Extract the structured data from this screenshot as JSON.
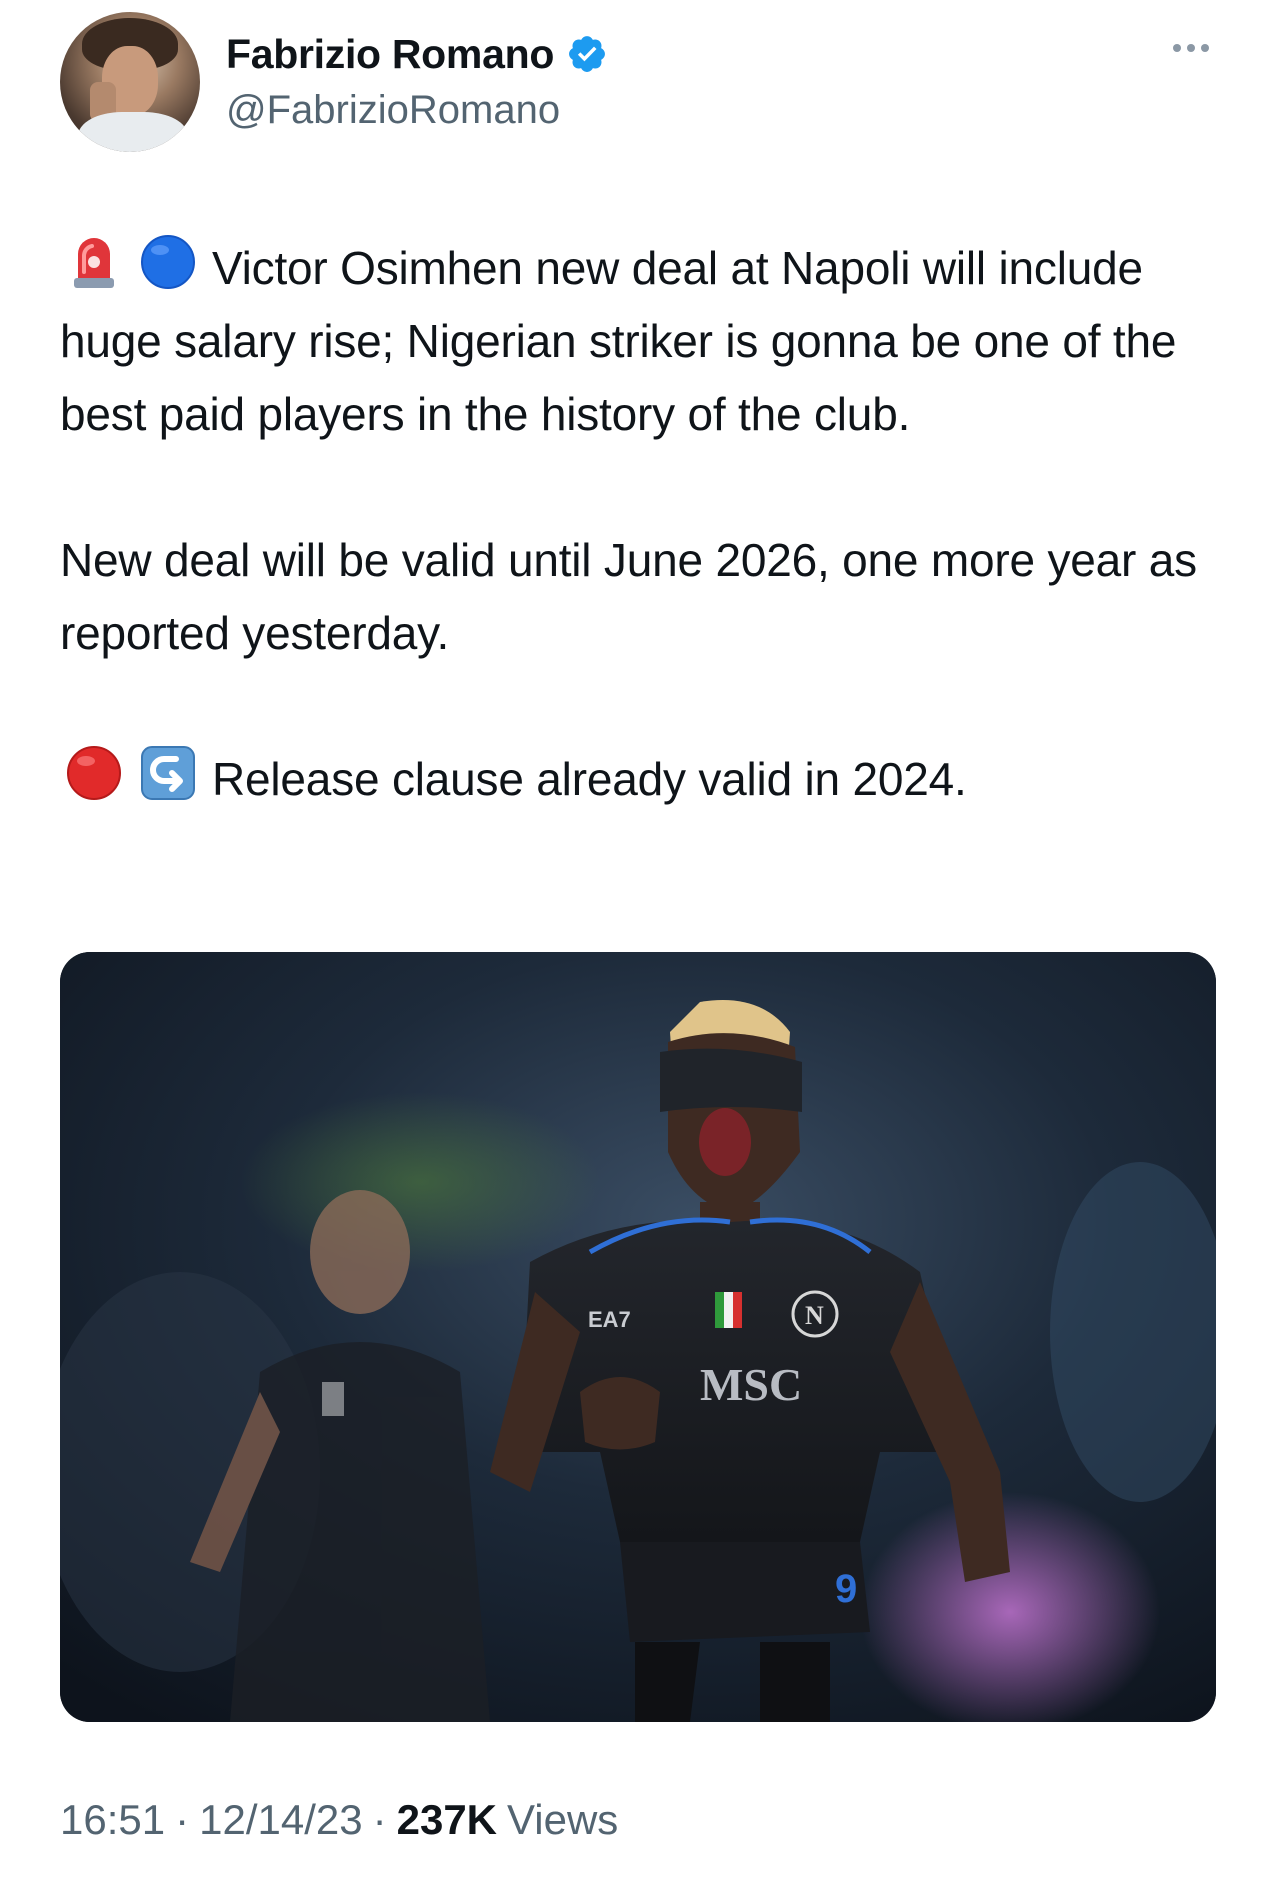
{
  "author": {
    "display_name": "Fabrizio Romano",
    "handle": "@FabrizioRomano",
    "verified": true,
    "verified_color": "#1d9bf0"
  },
  "menu": {
    "icon": "more-horizontal-icon"
  },
  "tweet": {
    "line1_emojis": [
      "rotating-light-emoji",
      "blue-circle-emoji"
    ],
    "paragraph1": "Victor Osimhen new deal at Napoli will include huge salary rise; Nigerian striker is gonna be one of the best paid players in the history of the club.",
    "paragraph2": "New deal will be valid until June 2026, one more year as reported yesterday.",
    "line3_emojis": [
      "red-circle-emoji",
      "right-arrow-curving-left-emoji"
    ],
    "paragraph3": "Release clause already valid in 2024."
  },
  "media": {
    "description_visible_text": [
      "EA7",
      "MSC",
      "N",
      "9"
    ]
  },
  "meta": {
    "time": "16:51",
    "sep1": "·",
    "date": "12/14/23",
    "sep2": "·",
    "views_count": "237K",
    "views_label": "Views"
  }
}
